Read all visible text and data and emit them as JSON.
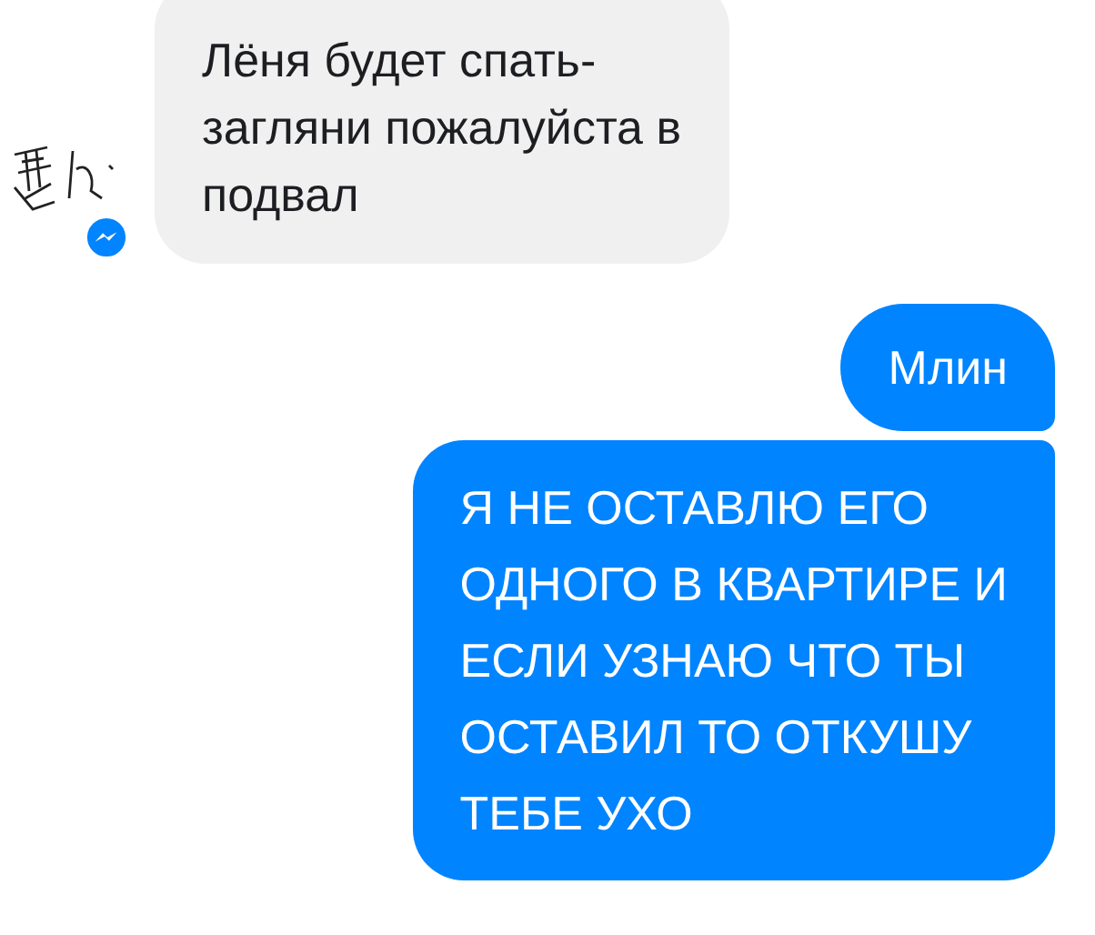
{
  "messages": [
    {
      "kind": "incoming",
      "text": "Лёня будет спать-\nзагляни пожалуйста в\nподвал"
    },
    {
      "kind": "outgoing",
      "text": "Млин"
    },
    {
      "kind": "outgoing",
      "text": "Я НЕ ОСТАВЛЮ ЕГО\nОДНОГО В КВАРТИРЕ И\nЕСЛИ УЗНАЮ ЧТО ТЫ\nОСТАВИЛ ТО ОТКУШУ\nТЕБЕ УХО"
    }
  ]
}
